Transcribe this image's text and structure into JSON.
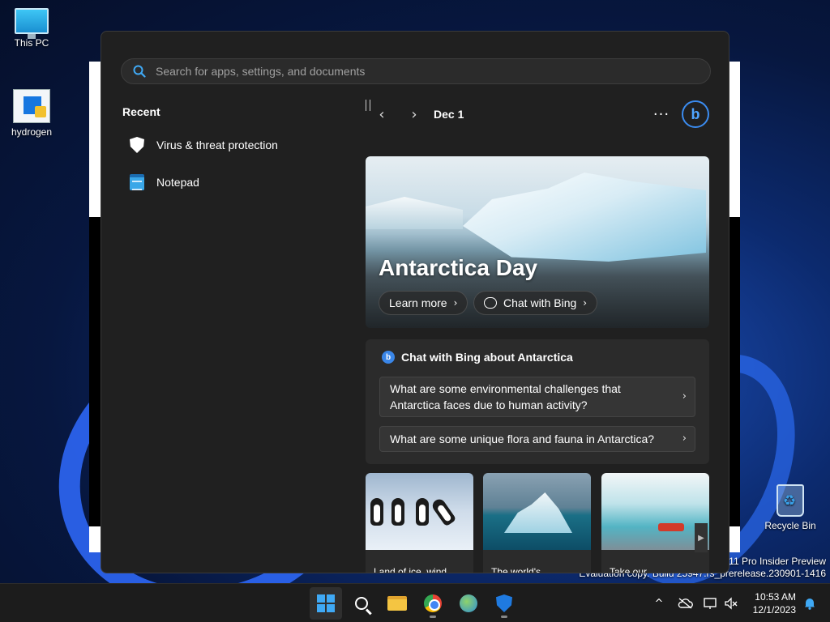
{
  "desktop": {
    "icons": [
      {
        "label": "This PC",
        "icon": "monitor-icon"
      },
      {
        "label": "hydrogen",
        "icon": "installer-icon"
      },
      {
        "label": "Recycle Bin",
        "icon": "recycle-bin-icon"
      }
    ],
    "watermark_line1": "s 11 Pro Insider Preview",
    "watermark_line2": "Evaluation copy. Build 25947.rs_prerelease.230901-1416"
  },
  "search": {
    "placeholder": "Search for apps, settings, and documents",
    "value": ""
  },
  "recent": {
    "title": "Recent",
    "items": [
      {
        "label": "Virus & threat protection",
        "icon": "shield-icon"
      },
      {
        "label": "Notepad",
        "icon": "notepad-icon"
      }
    ]
  },
  "highlights": {
    "date": "Dec 1",
    "prev_icon": "‹",
    "next_icon": "›",
    "more_label": "···",
    "bing_label": "b",
    "hero": {
      "title": "Antarctica Day",
      "learn_more": "Learn more",
      "chat_with_bing": "Chat with Bing"
    },
    "chat": {
      "heading": "Chat with Bing about Antarctica",
      "questions": [
        "What are some environmental challenges that Antarctica faces due to human activity?",
        "What are some unique flora and fauna in Antarctica?"
      ]
    },
    "tiles": [
      {
        "caption": "Land of ice, wind",
        "image": "penguins"
      },
      {
        "caption": "The world's",
        "image": "iceberg"
      },
      {
        "caption": "Take our",
        "image": "ice-cave-boat"
      }
    ]
  },
  "taskbar": {
    "apps": [
      {
        "name": "start",
        "icon": "windows-logo-icon"
      },
      {
        "name": "search",
        "icon": "search-icon"
      },
      {
        "name": "file-explorer",
        "icon": "folder-icon"
      },
      {
        "name": "chrome",
        "icon": "chrome-icon"
      },
      {
        "name": "network-globe",
        "icon": "globe-icon"
      },
      {
        "name": "defender",
        "icon": "shield-icon"
      }
    ],
    "tray": {
      "chevron": "^",
      "time": "10:53 AM",
      "date": "12/1/2023"
    }
  },
  "colors": {
    "flyout_bg": "#202020",
    "card_bg": "#2b2b2b",
    "accent": "#3fa9f5",
    "taskbar_bg": "#1c1c1c"
  }
}
